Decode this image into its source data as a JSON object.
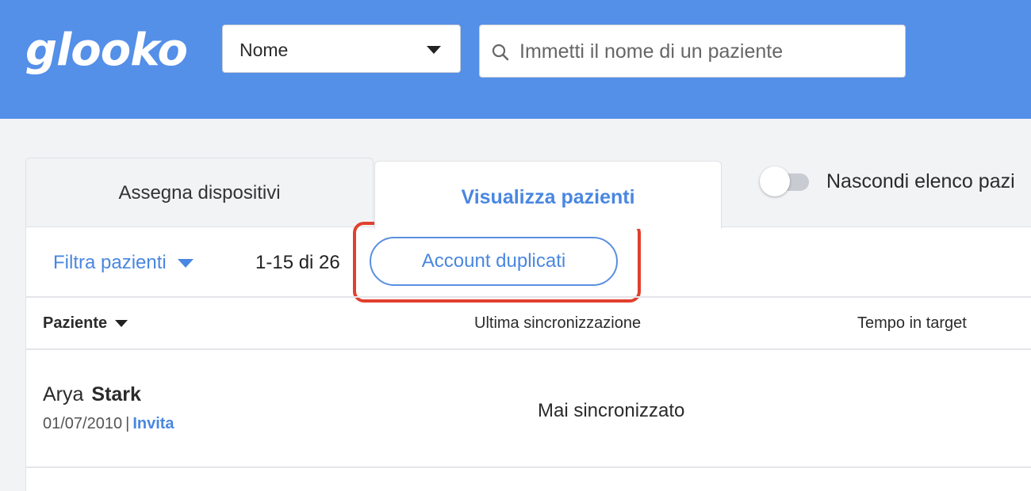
{
  "header": {
    "logo": "glooko",
    "search_type": "Nome",
    "search_placeholder": "Immetti il nome di un paziente"
  },
  "tabs": [
    {
      "label": "Assegna dispositivi",
      "active": false
    },
    {
      "label": "Visualizza pazienti",
      "active": true
    }
  ],
  "toggle": {
    "label": "Nascondi elenco pazi",
    "on": false
  },
  "toolbar": {
    "filter_label": "Filtra pazienti",
    "count": "1-15 di 26",
    "duplicates_button": "Account duplicati"
  },
  "table": {
    "columns": [
      "Paziente",
      "Ultima sincronizzazione",
      "Tempo in target"
    ],
    "rows": [
      {
        "first_name": "Arya",
        "last_name": "Stark",
        "dob": "01/07/2010",
        "separator": "|",
        "action": "Invita",
        "last_sync": "Mai sincronizzato"
      }
    ]
  },
  "colors": {
    "header_bg": "#548fe8",
    "accent": "#4a87e0",
    "highlight": "#e0402d"
  }
}
